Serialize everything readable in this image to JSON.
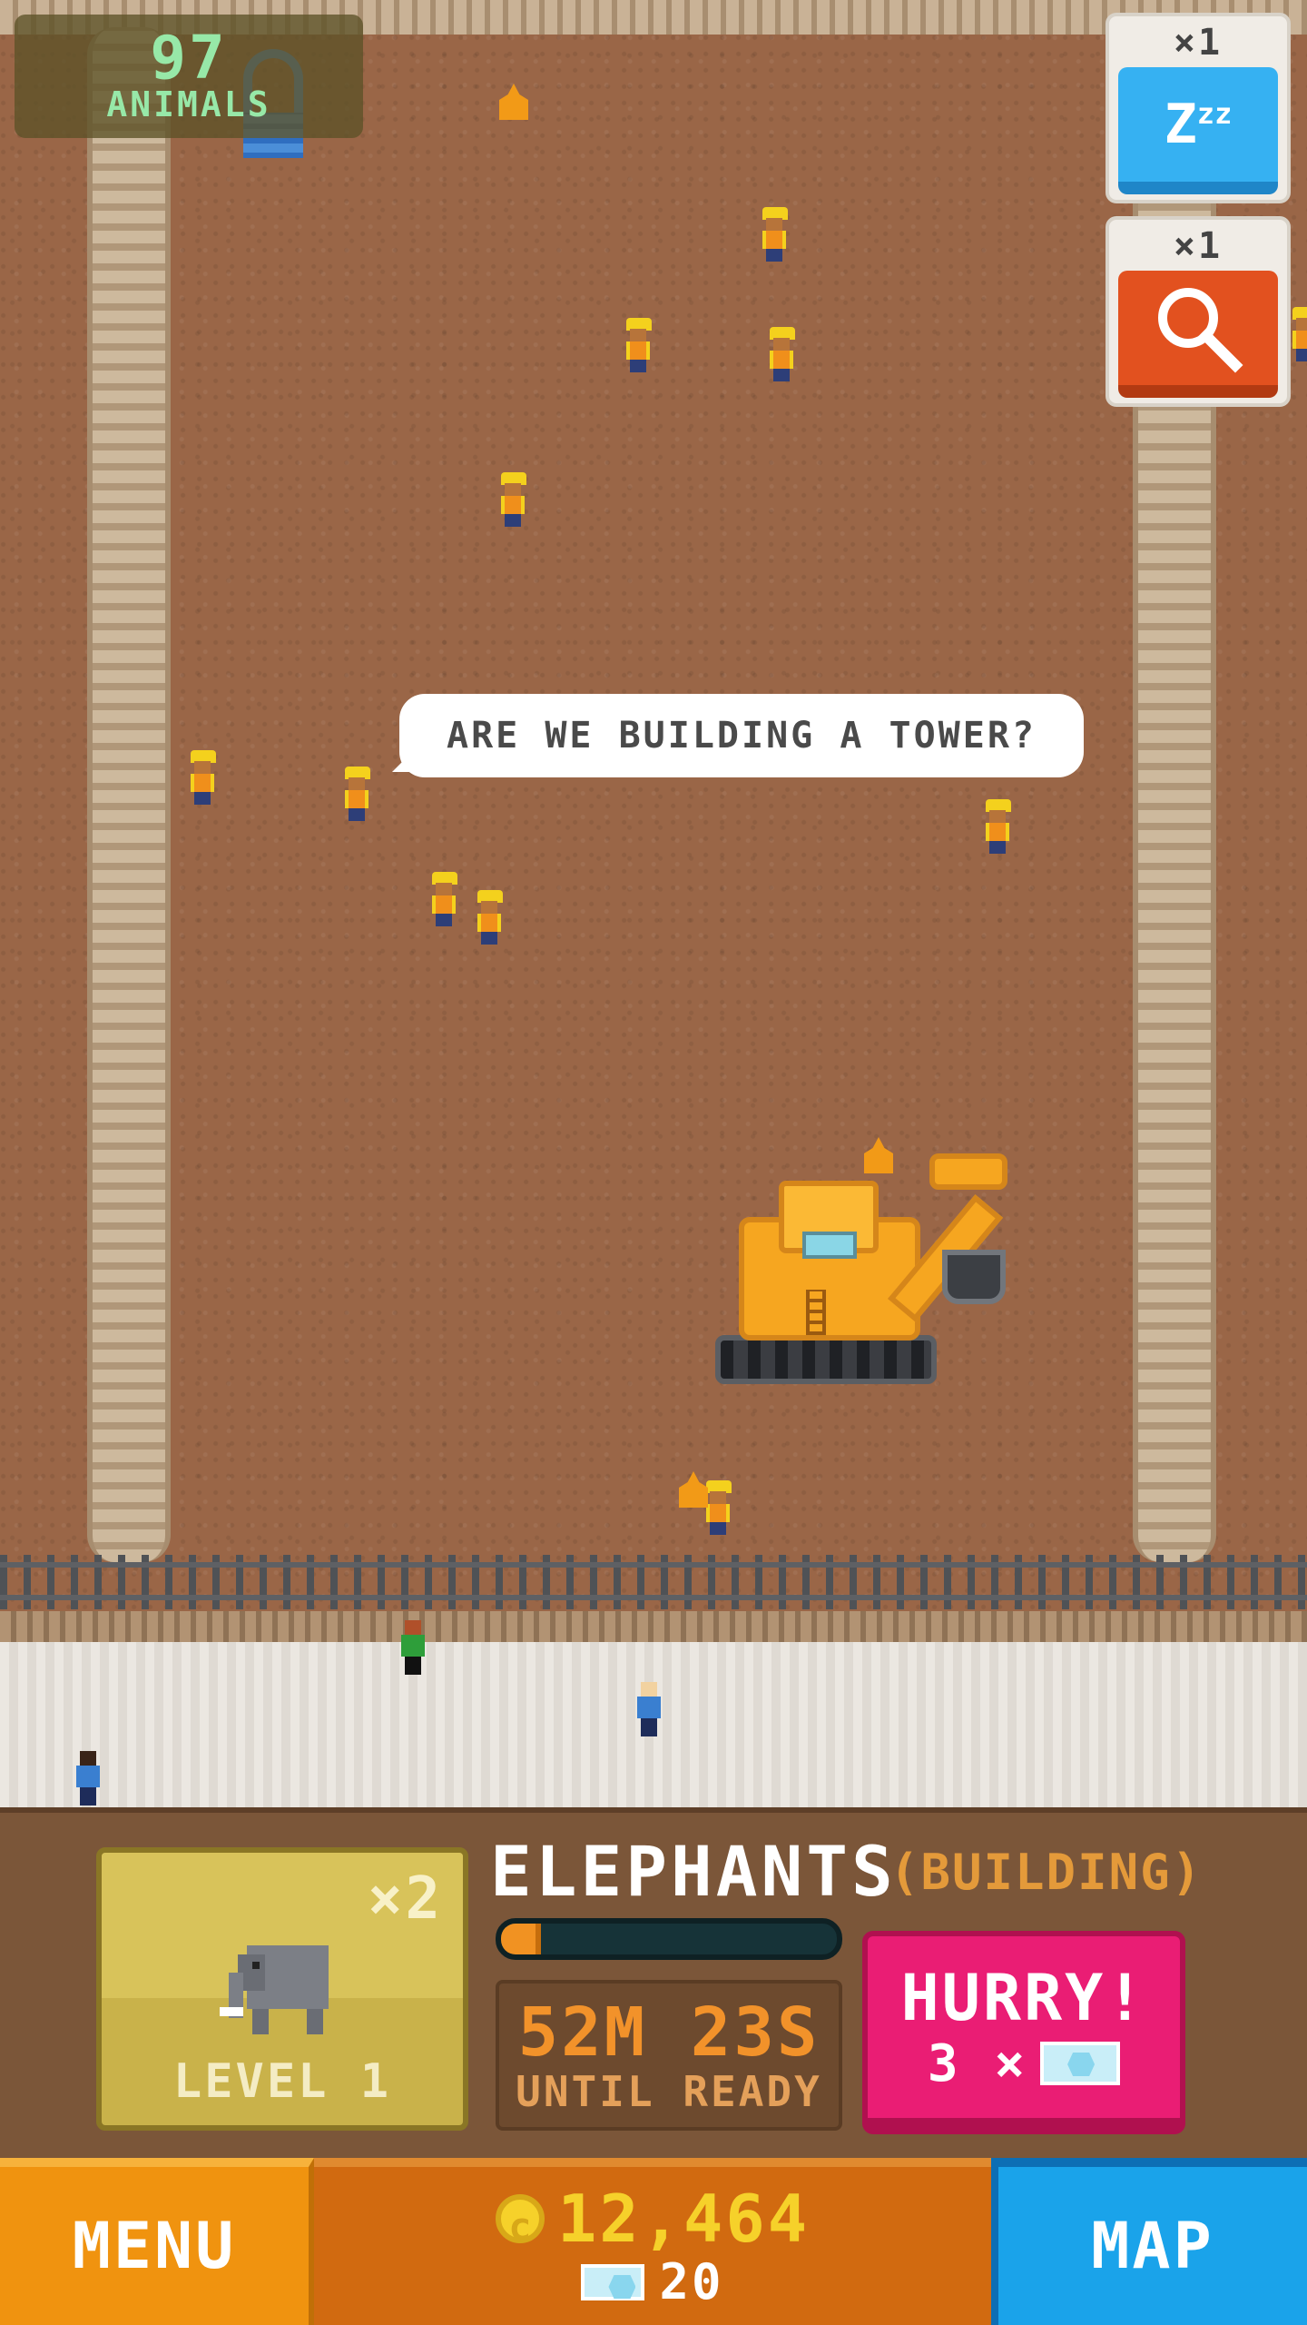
{
  "hud": {
    "animals_count": "97",
    "animals_label": "ANIMALS"
  },
  "powerups": [
    {
      "count": "×1",
      "icon": "sleep-zzz-icon",
      "color": "#36b1f2"
    },
    {
      "count": "×1",
      "icon": "magnifier-icon",
      "color": "#e2511f"
    }
  ],
  "speech_bubble": "ARE WE BUILDING A TOWER?",
  "enclosure": {
    "animal_name": "ELEPHANTS",
    "status": "(BUILDING)",
    "multiplier": "×2",
    "level": "LEVEL 1",
    "build_progress": 0.12,
    "timer": "52m 23s",
    "timer_label": "UNTIL READY"
  },
  "hurry": {
    "label": "HURRY!",
    "cost": "3 ×",
    "cost_icon": "gem-icon"
  },
  "bottom_bar": {
    "menu_label": "MENU",
    "coins": "12,464",
    "gems": "20",
    "map_label": "MAP"
  },
  "colors": {
    "dirt": "#9a6647",
    "hurry": "#ea1d74",
    "menu": "#f0930f",
    "map": "#1aa3ea",
    "coins": "#f6d12a"
  }
}
